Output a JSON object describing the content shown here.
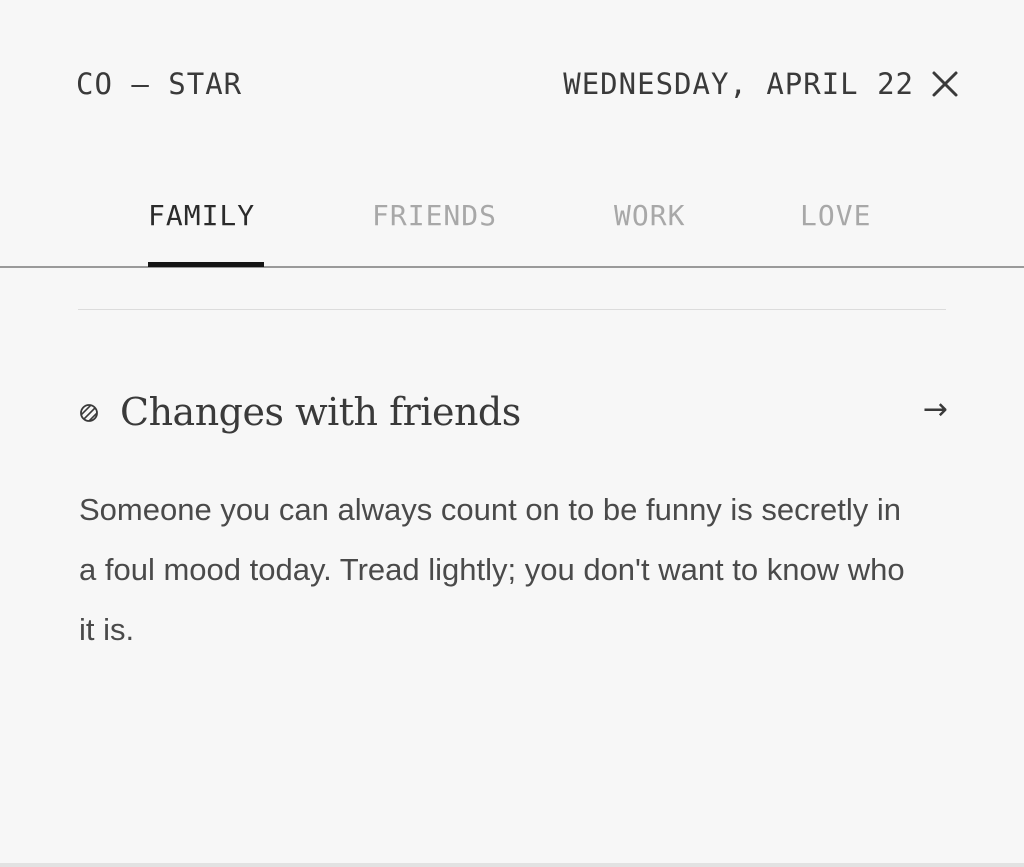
{
  "header": {
    "brand": "CO — STAR",
    "date": "WEDNESDAY, APRIL 22",
    "close_icon": "close-icon"
  },
  "tabs": [
    {
      "label": "FAMILY",
      "active": true
    },
    {
      "label": "FRIENDS",
      "active": false
    },
    {
      "label": "WORK",
      "active": false
    },
    {
      "label": "LOVE",
      "active": false
    }
  ],
  "section": {
    "icon": "striped-circle-icon",
    "title": "Changes with friends",
    "arrow": "→",
    "body": "Someone you can always count on to be funny is secretly in a foul mood today. Tread lightly; you don't want to know who it is."
  },
  "colors": {
    "background": "#f7f7f7",
    "text": "#3a3a3a",
    "inactive_tab": "#a8a8a8",
    "active_underline": "#151515"
  }
}
